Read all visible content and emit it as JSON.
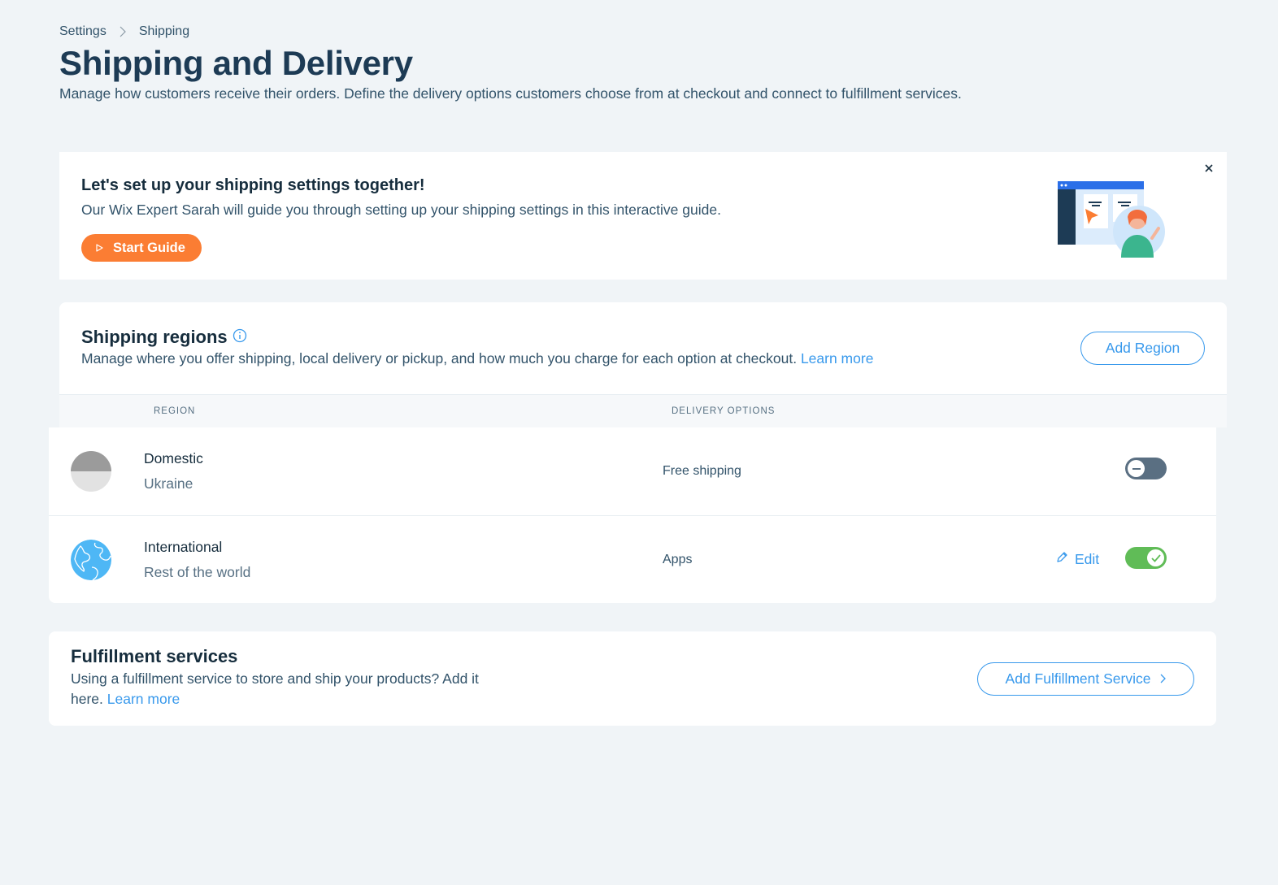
{
  "breadcrumb": {
    "items": [
      "Settings",
      "Shipping"
    ]
  },
  "page": {
    "title": "Shipping and Delivery",
    "description": "Manage how customers receive their orders. Define the delivery options customers choose from at checkout and connect to fulfillment services."
  },
  "guide": {
    "title": "Let's set up your shipping settings together!",
    "description": "Our Wix Expert Sarah will guide you through setting up your shipping settings in this interactive guide.",
    "button_label": "Start Guide"
  },
  "regions": {
    "title": "Shipping regions",
    "description": "Manage where you offer shipping, local delivery or pickup, and how much you charge for each option at checkout.",
    "learn_more": "Learn more",
    "add_button": "Add Region",
    "columns": [
      "REGION",
      "DELIVERY OPTIONS"
    ],
    "rows": [
      {
        "name": "Domestic",
        "sub": "Ukraine",
        "delivery": "Free shipping",
        "enabled": false,
        "icon": "flag-icon"
      },
      {
        "name": "International",
        "sub": "Rest of the world",
        "delivery": "Apps",
        "enabled": true,
        "edit_label": "Edit",
        "icon": "globe-icon"
      }
    ]
  },
  "fulfillment": {
    "title": "Fulfillment services",
    "description_line1": "Using a fulfillment service to store and ship your products? Add it",
    "description_line2": "here.",
    "learn_more": "Learn more",
    "add_button": "Add Fulfillment Service"
  },
  "colors": {
    "accent": "#3899ec",
    "primary_cta": "#fb7d33",
    "toggle_on": "#60bc57",
    "toggle_off": "#5a6f82",
    "page_bg": "#f0f4f7"
  }
}
